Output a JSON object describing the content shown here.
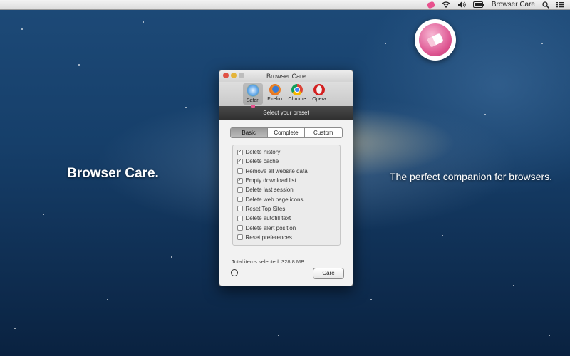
{
  "menubar": {
    "app_name": "Browser Care",
    "icons": [
      "browser-care-status-icon",
      "wifi-icon",
      "volume-icon",
      "battery-icon",
      "search-icon",
      "list-icon"
    ]
  },
  "desktop": {
    "left_title": "Browser Care.",
    "right_tagline": "The perfect companion for browsers."
  },
  "window": {
    "title": "Browser Care",
    "browsers": [
      {
        "label": "Safari",
        "icon": "safari-icon",
        "selected": true
      },
      {
        "label": "Firefox",
        "icon": "firefox-icon"
      },
      {
        "label": "Chrome",
        "icon": "chrome-icon"
      },
      {
        "label": "Opera",
        "icon": "opera-icon"
      }
    ],
    "preset_label": "Select your preset",
    "segments": [
      "Basic",
      "Complete",
      "Custom"
    ],
    "selected_segment": "Basic",
    "options": [
      {
        "label": "Delete history",
        "checked": true
      },
      {
        "label": "Delete cache",
        "checked": true
      },
      {
        "label": "Remove all website data",
        "checked": false
      },
      {
        "label": "Empty download list",
        "checked": true
      },
      {
        "label": "Delete last session",
        "checked": false
      },
      {
        "label": "Delete web page icons",
        "checked": false
      },
      {
        "label": "Reset Top Sites",
        "checked": false
      },
      {
        "label": "Delete autofill text",
        "checked": false
      },
      {
        "label": "Delete alert position",
        "checked": false
      },
      {
        "label": "Reset preferences",
        "checked": false
      }
    ],
    "total_text": "Total items selected: 328.8 MB",
    "care_button": "Care"
  },
  "colors": {
    "accent_pink": "#e8528e"
  }
}
